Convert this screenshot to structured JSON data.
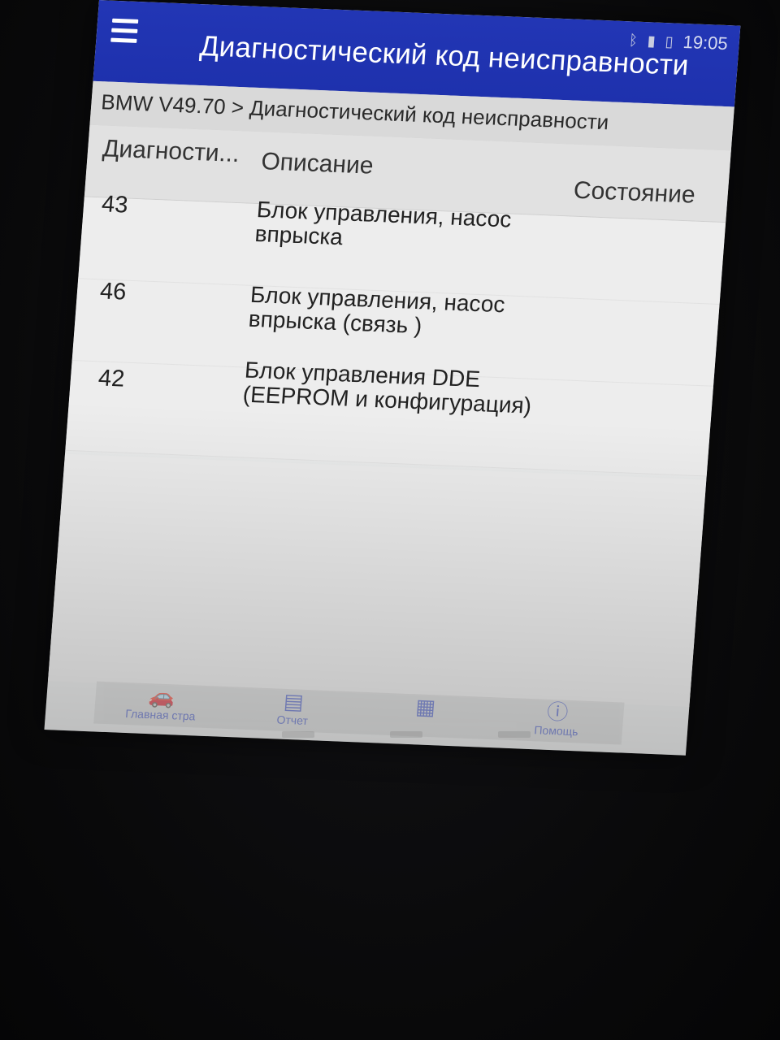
{
  "status_bar": {
    "time": "19:05",
    "icons": [
      "bluetooth-icon",
      "signal-icon",
      "battery-icon"
    ]
  },
  "app_bar": {
    "menu_icon": "hamburger-menu-icon",
    "title": "Диагностический код неисправности"
  },
  "breadcrumb": "BMW V49.70 > Диагностический код неисправности",
  "table": {
    "columns": [
      "Диагности...",
      "Описание",
      "Состояние"
    ],
    "rows": [
      {
        "code": "43",
        "description": "Блок управления, насос впрыска",
        "state": ""
      },
      {
        "code": "46",
        "description": "Блок управления, насос впрыска (связь )",
        "state": ""
      },
      {
        "code": "42",
        "description": "Блок управления DDE (EEPROM и конфигурация)",
        "state": ""
      }
    ]
  },
  "bottom_nav": {
    "items": [
      {
        "label": "Главная стра",
        "icon": "car-icon"
      },
      {
        "label": "Отчет",
        "icon": "report-icon"
      },
      {
        "label": "",
        "icon": "print-icon"
      },
      {
        "label": "Помощь",
        "icon": "info-icon"
      }
    ]
  },
  "colors": {
    "app_bar": "#1e31ad",
    "breadcrumb_bg": "#d9d9d9",
    "screen_bg": "#ececec",
    "text": "#222222"
  }
}
